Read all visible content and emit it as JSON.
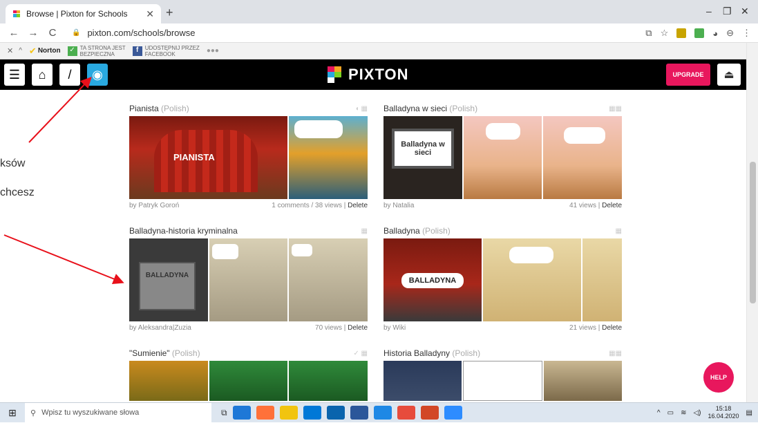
{
  "browser": {
    "tab_title": "Browse | Pixton for Schools",
    "url": "pixton.com/schools/browse",
    "nav": {
      "back": "←",
      "forward": "→",
      "reload": "C"
    },
    "norton": {
      "brand": "Norton",
      "secure_label_line1": "TA STRONA JEST",
      "secure_label_line2": "BEZPIECZNA",
      "share_line1": "UDOSTĘPNIJ PRZEZ",
      "share_line2": "FACEBOOK"
    }
  },
  "pixton": {
    "logo": "PIXTON",
    "upgrade": "UPGRADE",
    "help": "HELP"
  },
  "overlay": {
    "line1": "ksów",
    "line2": "chcesz"
  },
  "comics": [
    {
      "title": "Pianista",
      "lang": "(Polish)",
      "author": "by Patryk Goroń",
      "stats": "1 comments / 38 views | ",
      "delete": "Delete",
      "panel_text": "PIANISTA"
    },
    {
      "title": "Balladyna w sieci",
      "lang": "(Polish)",
      "author": "by Natalia",
      "stats": "41 views | ",
      "delete": "Delete",
      "panel_text": "Balladyna w sieci"
    },
    {
      "title": "Balladyna-historia kryminalna",
      "lang": "",
      "author": "by Aleksandra|Zuzia",
      "stats": "70 views | ",
      "delete": "Delete",
      "panel_text": "BALLADYNA"
    },
    {
      "title": "Balladyna",
      "lang": "(Polish)",
      "author": "by Wiki",
      "stats": "21 views | ",
      "delete": "Delete",
      "panel_text": "BALLADYNA"
    },
    {
      "title": "\"Sumienie\"",
      "lang": "(Polish)",
      "author": "",
      "stats": "",
      "delete": "",
      "panel_text": ""
    },
    {
      "title": "Historia Balladyny",
      "lang": "(Polish)",
      "author": "",
      "stats": "",
      "delete": "",
      "panel_text": ""
    }
  ],
  "taskbar": {
    "search_placeholder": "Wpisz tu wyszukiwane słowa",
    "time": "15:18",
    "date": "16.04.2020"
  },
  "colors": {
    "pixton_pink": "#e8175d",
    "pixton_blue": "#29a9e0",
    "arrow_red": "#e8101a"
  }
}
